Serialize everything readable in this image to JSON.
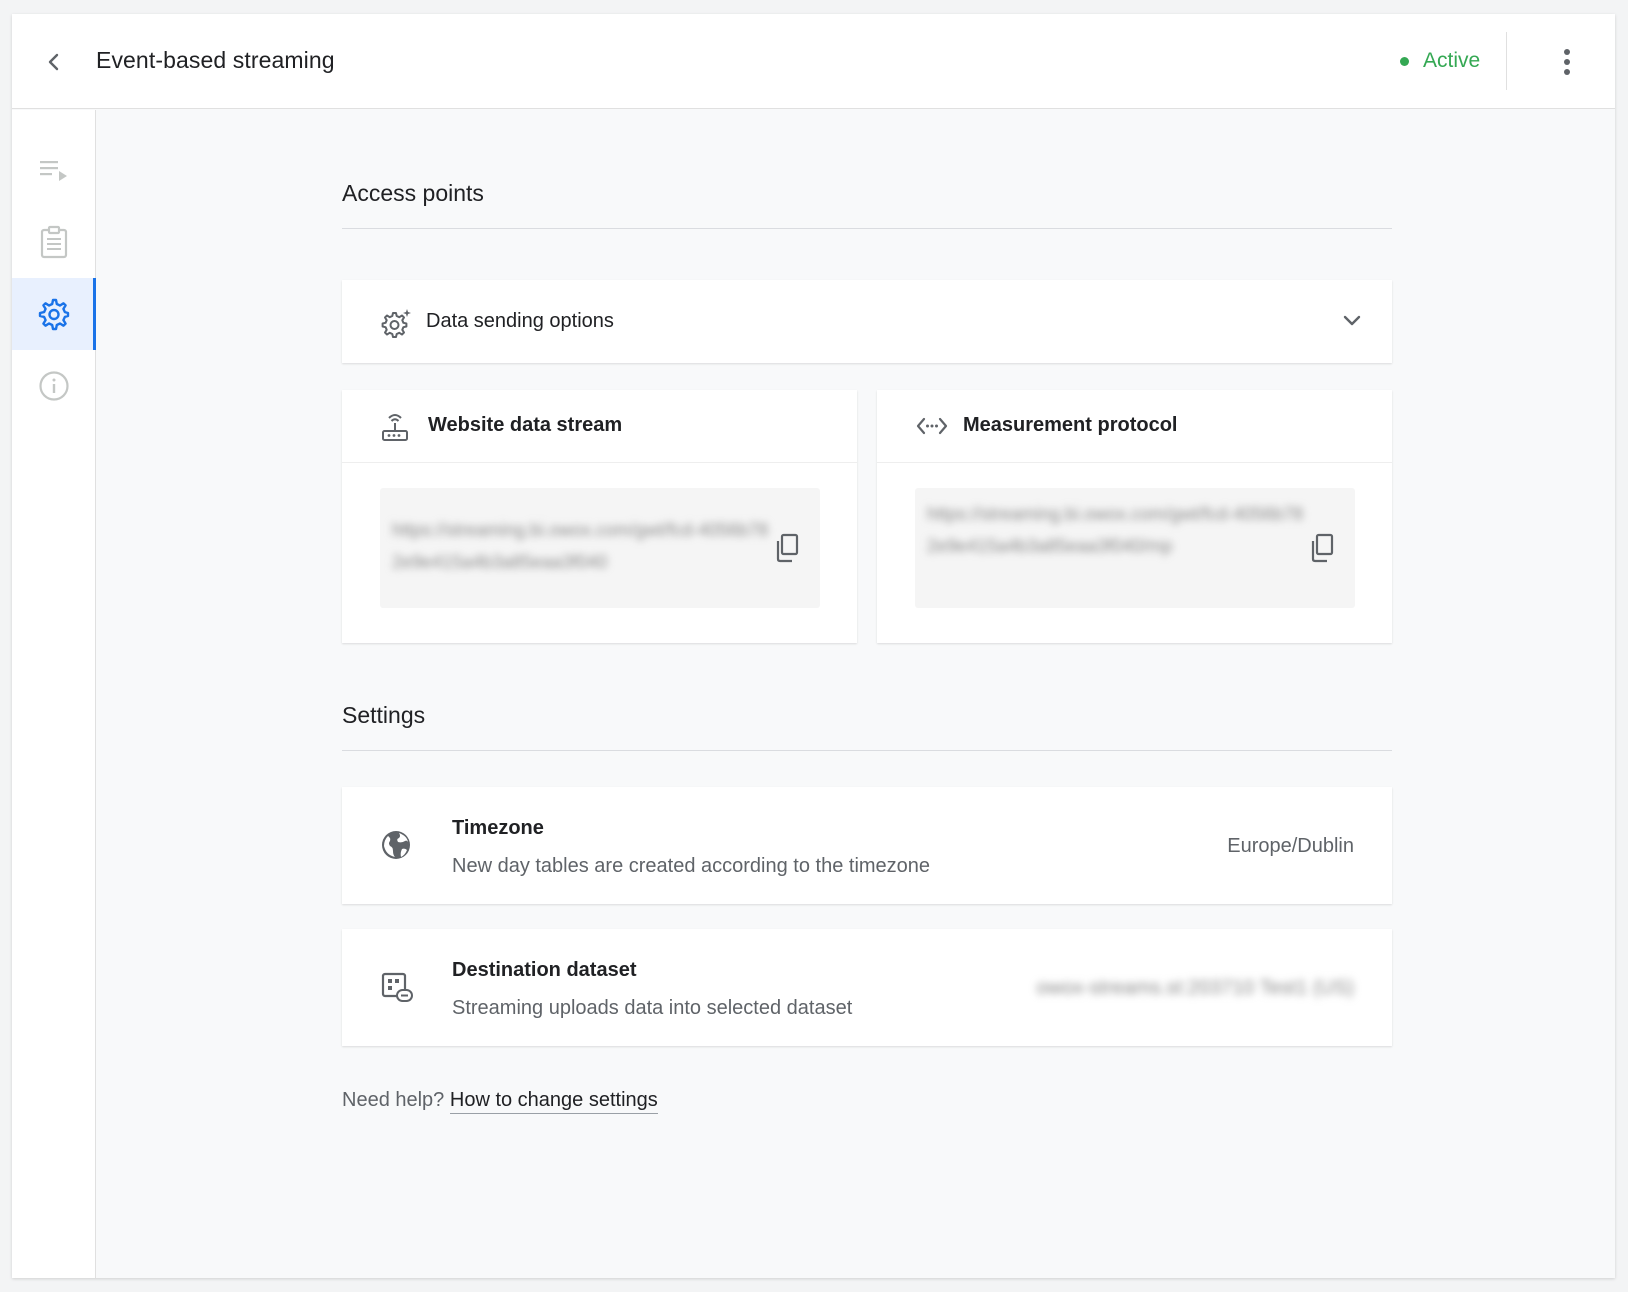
{
  "header": {
    "title": "Event-based streaming",
    "status": "Active"
  },
  "colors": {
    "accent": "#1a73e8",
    "status_active": "#34a853"
  },
  "sidebar": {
    "items": [
      {
        "icon": "playlist-icon",
        "active": false
      },
      {
        "icon": "clipboard-icon",
        "active": false
      },
      {
        "icon": "gear-icon",
        "active": true
      },
      {
        "icon": "info-icon",
        "active": false
      }
    ]
  },
  "access_points": {
    "title": "Access points",
    "data_sending_options": "Data sending options",
    "streams": [
      {
        "title": "Website data stream",
        "icon": "router-icon",
        "url": "https://streaming.bi.owox.com/gwt/fcd-4056b782e9e415a4b3a85eaa3f040"
      },
      {
        "title": "Measurement protocol",
        "icon": "code-icon",
        "url": "https://streaming.bi.owox.com/gwt/fcd-4056b782e9e415a4b3a85eaa3f040/mp"
      }
    ]
  },
  "settings": {
    "title": "Settings",
    "items": [
      {
        "icon": "globe-icon",
        "title": "Timezone",
        "description": "New day tables are created according to the timezone",
        "value": "Europe/Dublin"
      },
      {
        "icon": "dataset-link-icon",
        "title": "Destination dataset",
        "description": "Streaming uploads data into selected dataset",
        "value": "owox-streams.st:203710 Test1 (US)"
      }
    ]
  },
  "help": {
    "prefix": "Need help?",
    "link": "How to change settings"
  }
}
